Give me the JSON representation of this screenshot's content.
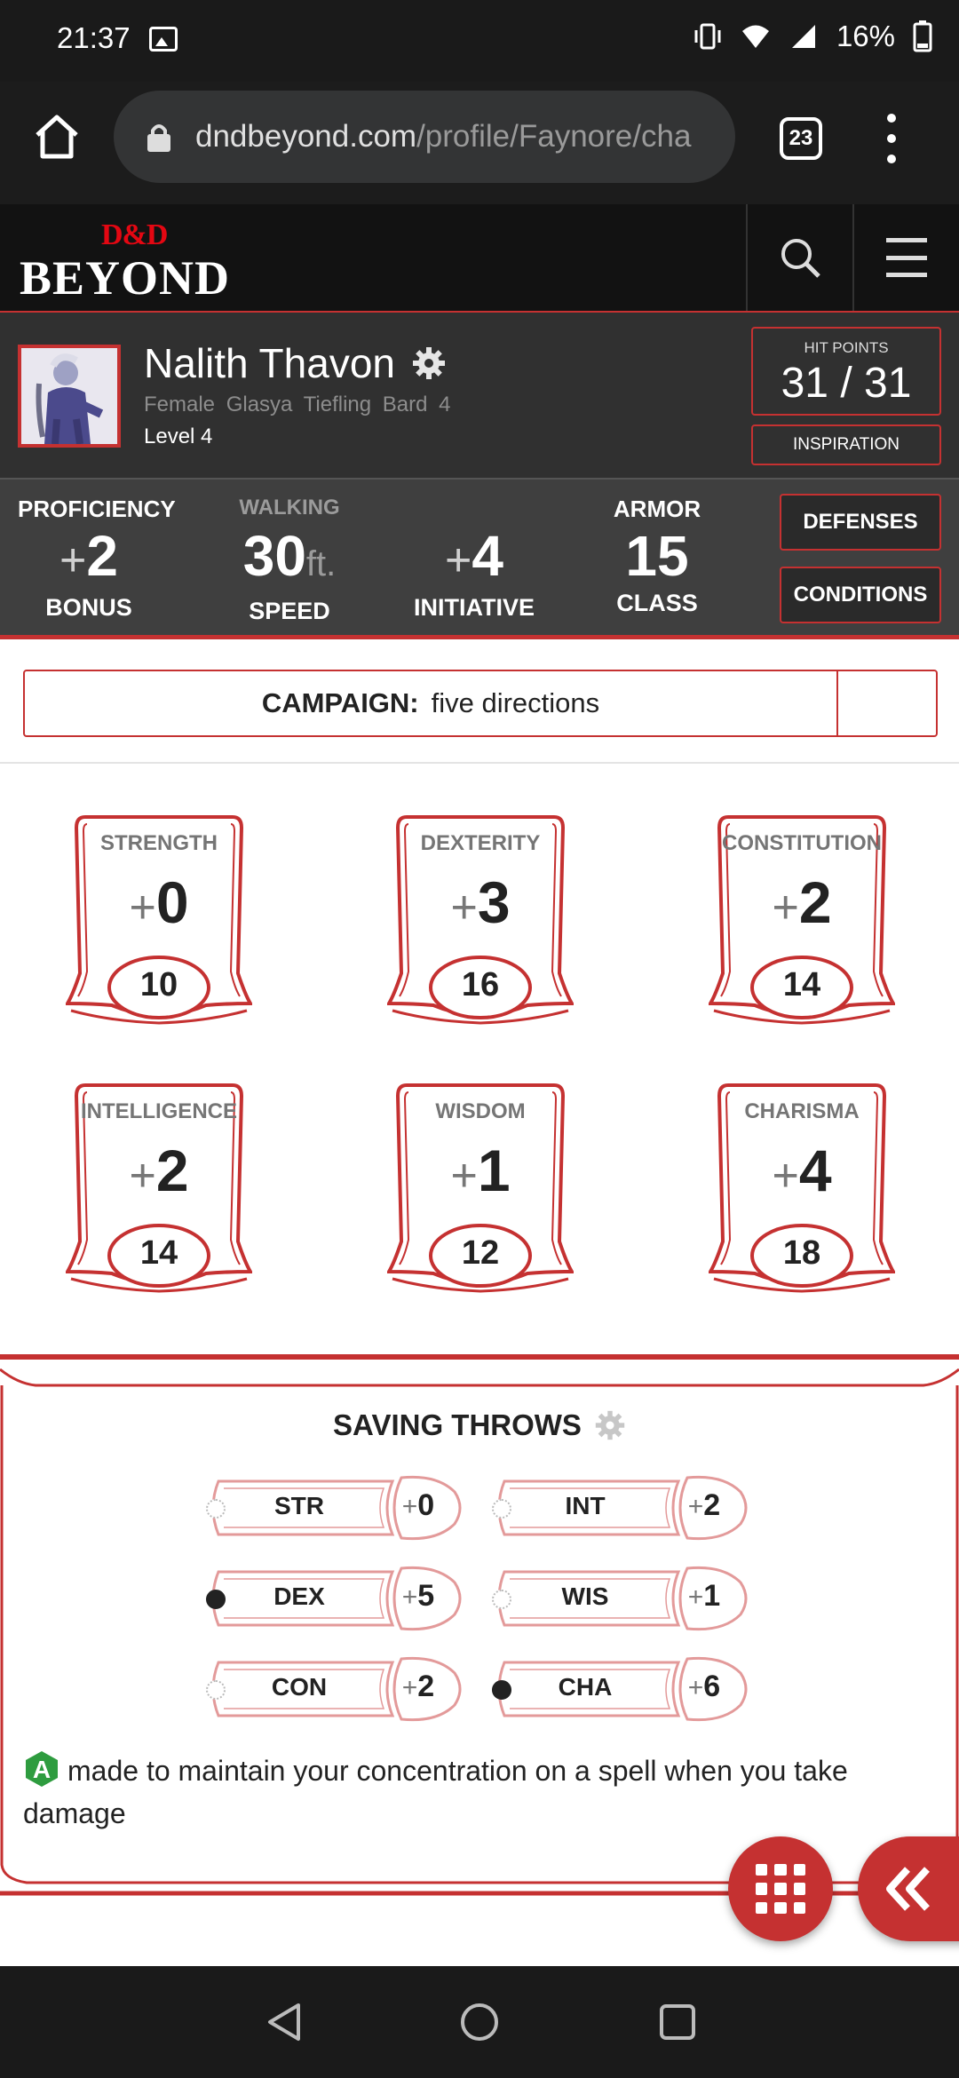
{
  "status": {
    "time": "21:37",
    "battery": "16%"
  },
  "browser": {
    "url_domain": "dndbeyond.com",
    "url_path": "/profile/Faynore/cha",
    "tab_count": "23"
  },
  "site": {
    "logo_dnd": "D&D",
    "logo_beyond": "BEYOND"
  },
  "character": {
    "name": "Nalith Thavon",
    "gender": "Female",
    "race": "Glasya Tiefling",
    "class": "Bard 4",
    "level": "Level 4",
    "hp_label": "HIT POINTS",
    "hp_value": "31 / 31",
    "inspiration_label": "INSPIRATION"
  },
  "stats": {
    "proficiency": {
      "top": "PROFICIENCY",
      "sign": "+",
      "value": "2",
      "bottom": "BONUS"
    },
    "speed": {
      "top": "WALKING",
      "value": "30",
      "unit": "ft.",
      "bottom": "SPEED"
    },
    "initiative": {
      "sign": "+",
      "value": "4",
      "bottom": "INITIATIVE"
    },
    "armor": {
      "top": "ARMOR",
      "value": "15",
      "bottom": "CLASS"
    },
    "defenses_label": "DEFENSES",
    "conditions_label": "CONDITIONS"
  },
  "campaign": {
    "label": "CAMPAIGN:",
    "name": "five directions"
  },
  "abilities": [
    {
      "name": "STRENGTH",
      "sign": "+",
      "mod": "0",
      "score": "10"
    },
    {
      "name": "DEXTERITY",
      "sign": "+",
      "mod": "3",
      "score": "16"
    },
    {
      "name": "CONSTITUTION",
      "sign": "+",
      "mod": "2",
      "score": "14"
    },
    {
      "name": "INTELLIGENCE",
      "sign": "+",
      "mod": "2",
      "score": "14"
    },
    {
      "name": "WISDOM",
      "sign": "+",
      "mod": "1",
      "score": "12"
    },
    {
      "name": "CHARISMA",
      "sign": "+",
      "mod": "4",
      "score": "18"
    }
  ],
  "saving_throws": {
    "title": "SAVING THROWS",
    "items": [
      {
        "label": "STR",
        "sign": "+",
        "value": "0",
        "proficient": false
      },
      {
        "label": "INT",
        "sign": "+",
        "value": "2",
        "proficient": false
      },
      {
        "label": "DEX",
        "sign": "+",
        "value": "5",
        "proficient": true
      },
      {
        "label": "WIS",
        "sign": "+",
        "value": "1",
        "proficient": false
      },
      {
        "label": "CON",
        "sign": "+",
        "value": "2",
        "proficient": false
      },
      {
        "label": "CHA",
        "sign": "+",
        "value": "6",
        "proficient": true
      }
    ],
    "advantage_icon_letter": "A",
    "advantage_text": "made to maintain your concentration on a spell when you take damage"
  },
  "colors": {
    "accent_red": "#c53131",
    "advantage_green": "#2e9c3f"
  },
  "icons": [
    "home-icon",
    "lock-icon",
    "tabs-icon",
    "more-icon",
    "search-icon",
    "menu-icon",
    "gear-icon",
    "grid-icon",
    "chevron-double-left-icon",
    "nav-back-icon",
    "nav-home-icon",
    "nav-recents-icon"
  ]
}
